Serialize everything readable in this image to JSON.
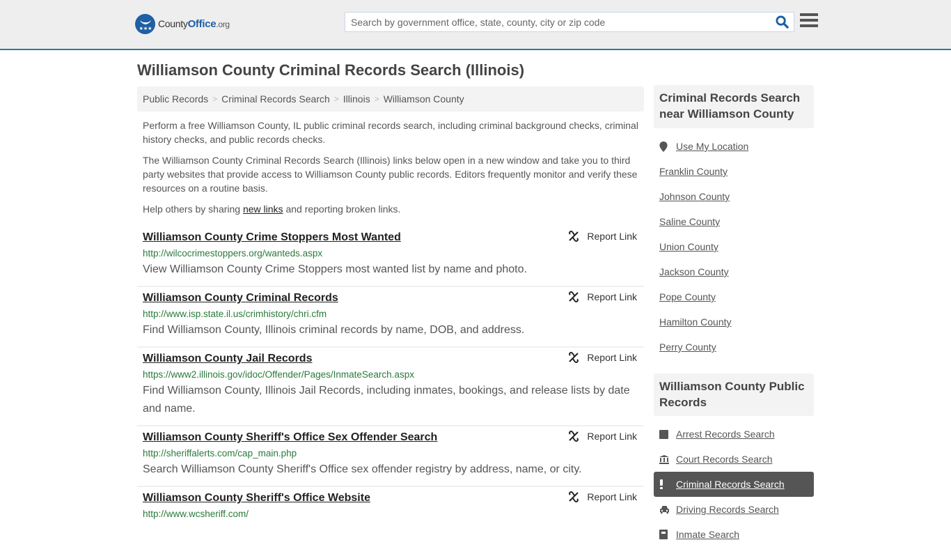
{
  "header": {
    "logo": {
      "county": "County",
      "office": "Office",
      "org": ".org"
    },
    "search_placeholder": "Search by government office, state, county, city or zip code",
    "search_value": ""
  },
  "page_title": "Williamson County Criminal Records Search (Illinois)",
  "breadcrumb": [
    {
      "label": "Public Records"
    },
    {
      "label": "Criminal Records Search"
    },
    {
      "label": "Illinois"
    },
    {
      "label": "Williamson County"
    }
  ],
  "intro": {
    "p1": "Perform a free Williamson County, IL public criminal records search, including criminal background checks, criminal history checks, and public records checks.",
    "p2": "The Williamson County Criminal Records Search (Illinois) links below open in a new window and take you to third party websites that provide access to Williamson County public records. Editors frequently monitor and verify these resources on a routine basis.",
    "p3_before": "Help others by sharing ",
    "p3_link": "new links",
    "p3_after": " and reporting broken links."
  },
  "report_label": "Report Link",
  "results": [
    {
      "title": "Williamson County Crime Stoppers Most Wanted",
      "url": "http://wilcocrimestoppers.org/wanteds.aspx",
      "desc": "View Williamson County Crime Stoppers most wanted list by name and photo."
    },
    {
      "title": "Williamson County Criminal Records",
      "url": "http://www.isp.state.il.us/crimhistory/chri.cfm",
      "desc": "Find Williamson County, Illinois criminal records by name, DOB, and address."
    },
    {
      "title": "Williamson County Jail Records",
      "url": "https://www2.illinois.gov/idoc/Offender/Pages/InmateSearch.aspx",
      "desc": "Find Williamson County, Illinois Jail Records, including inmates, bookings, and release lists by date and name."
    },
    {
      "title": "Williamson County Sheriff's Office Sex Offender Search",
      "url": "http://sheriffalerts.com/cap_main.php",
      "desc": "Search Williamson County Sheriff's Office sex offender registry by address, name, or city."
    },
    {
      "title": "Williamson County Sheriff's Office Website",
      "url": "http://www.wcsheriff.com/",
      "desc": ""
    }
  ],
  "sidebar": {
    "nearby_title": "Criminal Records Search near Williamson County",
    "use_location": "Use My Location",
    "nearby": [
      "Franklin County",
      "Johnson County",
      "Saline County",
      "Union County",
      "Jackson County",
      "Pope County",
      "Hamilton County",
      "Perry County"
    ],
    "public_title": "Williamson County Public Records",
    "public_links": [
      {
        "label": "Arrest Records Search",
        "icon": "arrest-icon",
        "active": false
      },
      {
        "label": "Court Records Search",
        "icon": "courthouse-icon",
        "active": false
      },
      {
        "label": "Criminal Records Search",
        "icon": "exclamation-icon",
        "active": true
      },
      {
        "label": "Driving Records Search",
        "icon": "car-icon",
        "active": false
      },
      {
        "label": "Inmate Search",
        "icon": "inmate-icon",
        "active": false
      }
    ]
  },
  "colors": {
    "brand_blue": "#1f5fa3",
    "header_border": "#2f75a9",
    "url_green": "#2a7a3b",
    "active_bg": "#555555"
  }
}
